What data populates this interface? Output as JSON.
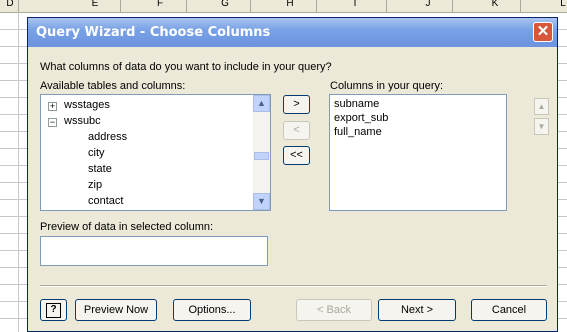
{
  "spreadsheet": {
    "column_letters": [
      "D",
      "E",
      "F",
      "G",
      "H",
      "I",
      "J",
      "K",
      "L"
    ]
  },
  "dialog": {
    "title": "Query Wizard - Choose Columns",
    "close_glyph": "✕",
    "prompt": "What columns of data do you want to include in your query?",
    "available_label": "Available tables and columns:",
    "query_label": "Columns in your query:",
    "preview_label": "Preview of data in selected column:",
    "available_items": [
      {
        "expander": "+",
        "label": "wsstages"
      },
      {
        "expander": "−",
        "label": "wssubc"
      },
      {
        "label": "address"
      },
      {
        "label": "city"
      },
      {
        "label": "state"
      },
      {
        "label": "zip"
      },
      {
        "label": "contact"
      }
    ],
    "query_items": [
      "subname",
      "export_sub",
      "full_name"
    ],
    "move_buttons": {
      "add": ">",
      "remove": "<",
      "remove_all": "<<"
    },
    "buttons": {
      "help": "?",
      "preview_now": "Preview Now",
      "options": "Options...",
      "back": "< Back",
      "next": "Next >",
      "cancel": "Cancel"
    }
  },
  "colors": {
    "titlebar": "#7aa2e6",
    "dialog_bg": "#ece9d8",
    "close": "#d8573a"
  }
}
